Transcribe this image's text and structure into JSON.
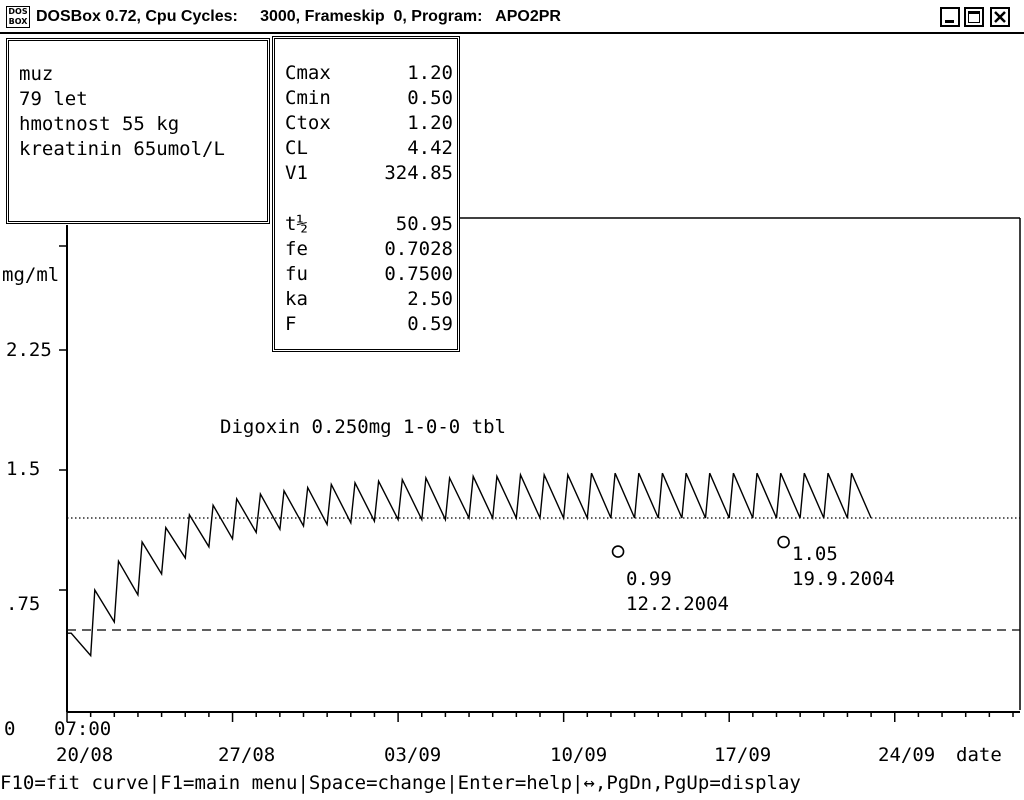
{
  "window": {
    "title_left": "DOSBox 0.72, Cpu Cycles:",
    "title_right": "3000, Frameskip  0, Program:   APO2PR",
    "icon_label": "DOS BOX"
  },
  "patient": {
    "lines": [
      "muz",
      "79 let",
      "hmotnost 55 kg",
      "kreatinin 65umol/L"
    ]
  },
  "params": [
    {
      "key": "Cmax",
      "value": "1.20"
    },
    {
      "key": "Cmin",
      "value": "0.50"
    },
    {
      "key": "Ctox",
      "value": "1.20"
    },
    {
      "key": "CL",
      "value": "4.42"
    },
    {
      "key": "V1",
      "value": "324.85"
    },
    {
      "key": "t½",
      "value": "50.95"
    },
    {
      "key": "fe",
      "value": "0.7028"
    },
    {
      "key": "fu",
      "value": "0.7500"
    },
    {
      "key": "ka",
      "value": "2.50"
    },
    {
      "key": "F",
      "value": "0.59"
    }
  ],
  "chart_data": {
    "type": "line",
    "title": "Digoxin 0.250mg 1-0-0 tbl",
    "ylabel": "mg/ml",
    "xlabel": "date",
    "ylim": [
      0,
      3.0
    ],
    "y_ticks": [
      {
        "value": 0.75,
        "label": ".75"
      },
      {
        "value": 1.5,
        "label": "1.5"
      },
      {
        "value": 2.25,
        "label": "2.25"
      }
    ],
    "y_zero_label": "0",
    "x_ticks": [
      "20/08",
      "27/08",
      "03/09",
      "10/09",
      "17/09",
      "24/09"
    ],
    "x_start_time": "07:00",
    "x_range_days": [
      0,
      33
    ],
    "reference_lines": [
      {
        "name": "Cmax/Ctox",
        "value": 1.2,
        "style": "dotted"
      },
      {
        "name": "Cmin",
        "value": 0.5,
        "style": "dashed"
      }
    ],
    "series": [
      {
        "dose_interval_days": 1,
        "peaks": [
          0.48,
          0.75,
          0.93,
          1.05,
          1.14,
          1.22,
          1.28,
          1.32,
          1.35,
          1.37,
          1.39,
          1.41,
          1.42,
          1.43,
          1.44,
          1.45,
          1.45,
          1.46,
          1.46,
          1.47,
          1.47,
          1.47,
          1.48,
          1.48,
          1.48,
          1.48,
          1.48,
          1.48,
          1.48,
          1.48,
          1.48,
          1.48,
          1.48,
          1.48
        ],
        "troughs": [
          0.34,
          0.55,
          0.72,
          0.85,
          0.95,
          1.02,
          1.07,
          1.11,
          1.13,
          1.15,
          1.16,
          1.17,
          1.18,
          1.19,
          1.19,
          1.19,
          1.2,
          1.2,
          1.2,
          1.2,
          1.2,
          1.2,
          1.2,
          1.2,
          1.2,
          1.2,
          1.2,
          1.2,
          1.2,
          1.2,
          1.2,
          1.2,
          1.2,
          1.2
        ]
      }
    ],
    "measurements": [
      {
        "value": "0.99",
        "date": "12.2.2004",
        "y": 0.99,
        "day": 23.3
      },
      {
        "value": "1.05",
        "date": "19.9.2004",
        "y": 1.05,
        "day": 30.3
      }
    ]
  },
  "status_bar": [
    "F10=fit curve",
    "F1=main menu",
    "Space=change",
    "Enter=help",
    "↔,PgDn,PgUp=display"
  ]
}
